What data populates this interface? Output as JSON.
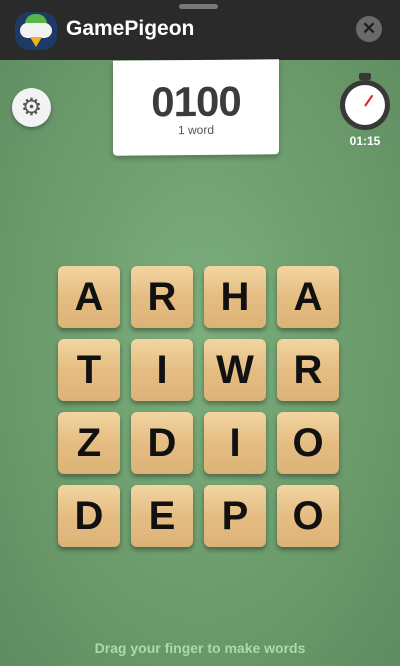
{
  "header": {
    "title": "GamePigeon",
    "close_icon": "close-icon"
  },
  "game": {
    "score": "0100",
    "words_label": "1 word",
    "timer": "01:15",
    "settings_icon": "gear-icon"
  },
  "grid": [
    [
      "A",
      "R",
      "H",
      "A"
    ],
    [
      "T",
      "I",
      "W",
      "R"
    ],
    [
      "Z",
      "D",
      "I",
      "O"
    ],
    [
      "D",
      "E",
      "P",
      "O"
    ]
  ],
  "hint": "Drag your finger to make words",
  "colors": {
    "board": "#6c9a6c",
    "hint": "#a8dca8",
    "topbar": "#2a2a2a"
  }
}
